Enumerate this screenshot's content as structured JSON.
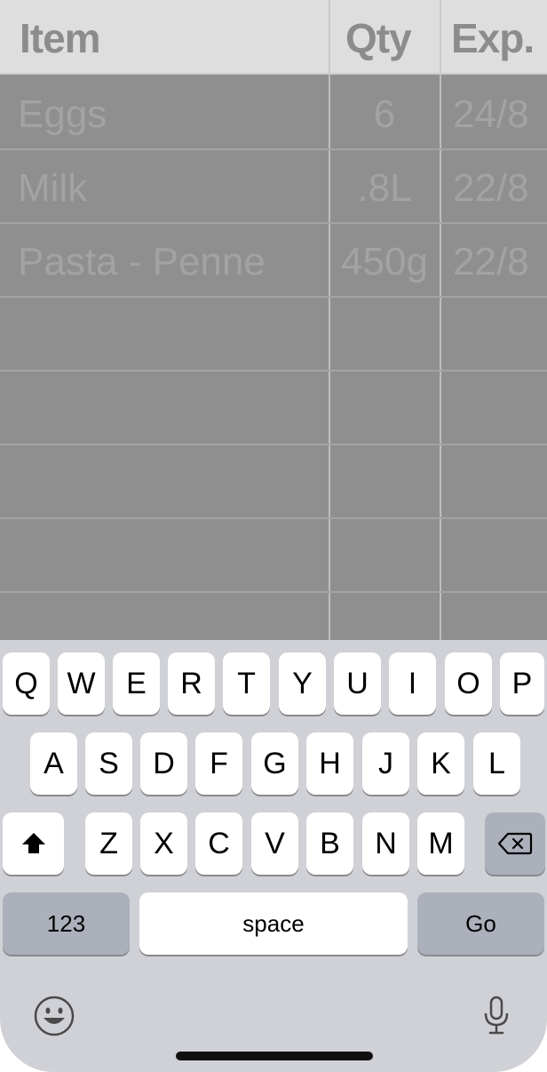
{
  "table": {
    "headers": {
      "item": "Item",
      "qty": "Qty",
      "exp": "Exp."
    },
    "rows": [
      {
        "item": "Eggs",
        "qty": "6",
        "exp": "24/8"
      },
      {
        "item": "Milk",
        "qty": ".8L",
        "exp": "22/8"
      },
      {
        "item": "Pasta - Penne",
        "qty": "450g",
        "exp": "22/8"
      },
      {
        "item": "",
        "qty": "",
        "exp": ""
      },
      {
        "item": "",
        "qty": "",
        "exp": ""
      },
      {
        "item": "",
        "qty": "",
        "exp": ""
      },
      {
        "item": "",
        "qty": "",
        "exp": ""
      },
      {
        "item": "",
        "qty": "",
        "exp": ""
      }
    ]
  },
  "keyboard": {
    "row1": [
      "Q",
      "W",
      "E",
      "R",
      "T",
      "Y",
      "U",
      "I",
      "O",
      "P"
    ],
    "row2": [
      "A",
      "S",
      "D",
      "F",
      "G",
      "H",
      "J",
      "K",
      "L"
    ],
    "row3": [
      "Z",
      "X",
      "C",
      "V",
      "B",
      "N",
      "M"
    ],
    "numbers_label": "123",
    "space_label": "space",
    "go_label": "Go",
    "shift_icon": "shift-icon",
    "delete_icon": "delete-icon",
    "emoji_icon": "emoji-icon",
    "mic_icon": "microphone-icon"
  },
  "colors": {
    "dim_overlay": "#8f8f8f",
    "header_bg": "#dedede",
    "keyboard_bg": "#d0d1d6",
    "key_bg": "#ffffff",
    "dark_key_bg": "#abb0bb"
  }
}
